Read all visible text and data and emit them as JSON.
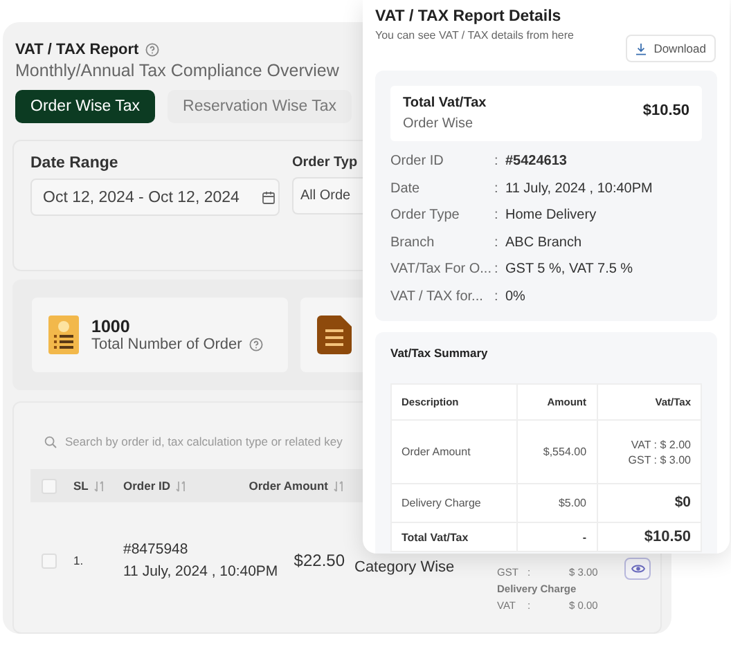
{
  "report": {
    "title": "VAT / TAX Report",
    "subtitle": "Monthly/Annual Tax Compliance Overview"
  },
  "tabs": [
    {
      "label": "Order Wise Tax",
      "selected": true
    },
    {
      "label": "Reservation Wise Tax",
      "selected": false
    }
  ],
  "filters": [
    {
      "kind": "date",
      "label": "Date Range",
      "value": "Oct 12, 2024 - Oct 12, 2024"
    },
    {
      "kind": "select",
      "label": "Order Typ",
      "value": "All Orde"
    }
  ],
  "stats": [
    {
      "kind": "orders",
      "value": "1000",
      "label": "Total Number of Order"
    },
    {
      "kind": "document"
    }
  ],
  "table": {
    "search": {
      "placeholder": "Search by order id, tax calculation type or related key"
    },
    "select_all": {
      "checked": false
    },
    "columns": [
      "SL",
      "Order ID",
      "Order Amount"
    ],
    "rows": [
      {
        "checked": false,
        "sl": "1.",
        "order_id": "#8475948",
        "date": "11 July, 2024 , 10:40PM",
        "amount": "$22.50",
        "tax_type": "Category Wise",
        "tax_lines": [
          {
            "kind": "line",
            "label": "GST",
            "sep": ":",
            "value": "$ 3.00"
          },
          {
            "kind": "heading",
            "label": "Delivery Charge"
          },
          {
            "kind": "line",
            "label": "VAT",
            "sep": ":",
            "value": "$ 0.00"
          }
        ]
      }
    ]
  },
  "details": {
    "title": "VAT / TAX Report Details",
    "subtitle": "You can see VAT / TAX details from here",
    "download": "Download",
    "total": {
      "label": "Total Vat/Tax",
      "sub": "Order Wise",
      "amount": "$10.50"
    },
    "rows": [
      {
        "label": "Order ID",
        "sep": ":",
        "value": "#5424613",
        "bold": true
      },
      {
        "label": "Date",
        "sep": ":",
        "value": "11 July, 2024 , 10:40PM",
        "bold": false
      },
      {
        "label": "Order Type",
        "sep": ":",
        "value": "Home Delivery",
        "bold": false
      },
      {
        "label": "Branch",
        "sep": ":",
        "value": "ABC Branch",
        "bold": false
      },
      {
        "label": "VAT/Tax For O...",
        "sep": ":",
        "value": "GST 5 %, VAT 7.5 %",
        "bold": false
      },
      {
        "label": "VAT / TAX for...",
        "sep": ":",
        "value": "0%",
        "bold": false
      }
    ],
    "summary": {
      "title": "Vat/Tax Summary",
      "columns": [
        "Description",
        "Amount",
        "Vat/Tax"
      ],
      "rows": [
        {
          "kind": "item",
          "description": "Order Amount",
          "amount": "$,554.00",
          "tax": [
            "VAT : $ 2.00",
            "GST : $ 3.00"
          ]
        },
        {
          "kind": "item",
          "description": "Delivery Charge",
          "amount": "$5.00",
          "tax": [
            "$0"
          ]
        },
        {
          "kind": "total",
          "description": "Total Vat/Tax",
          "amount": "-",
          "tax": [
            "$10.50"
          ]
        }
      ]
    }
  }
}
